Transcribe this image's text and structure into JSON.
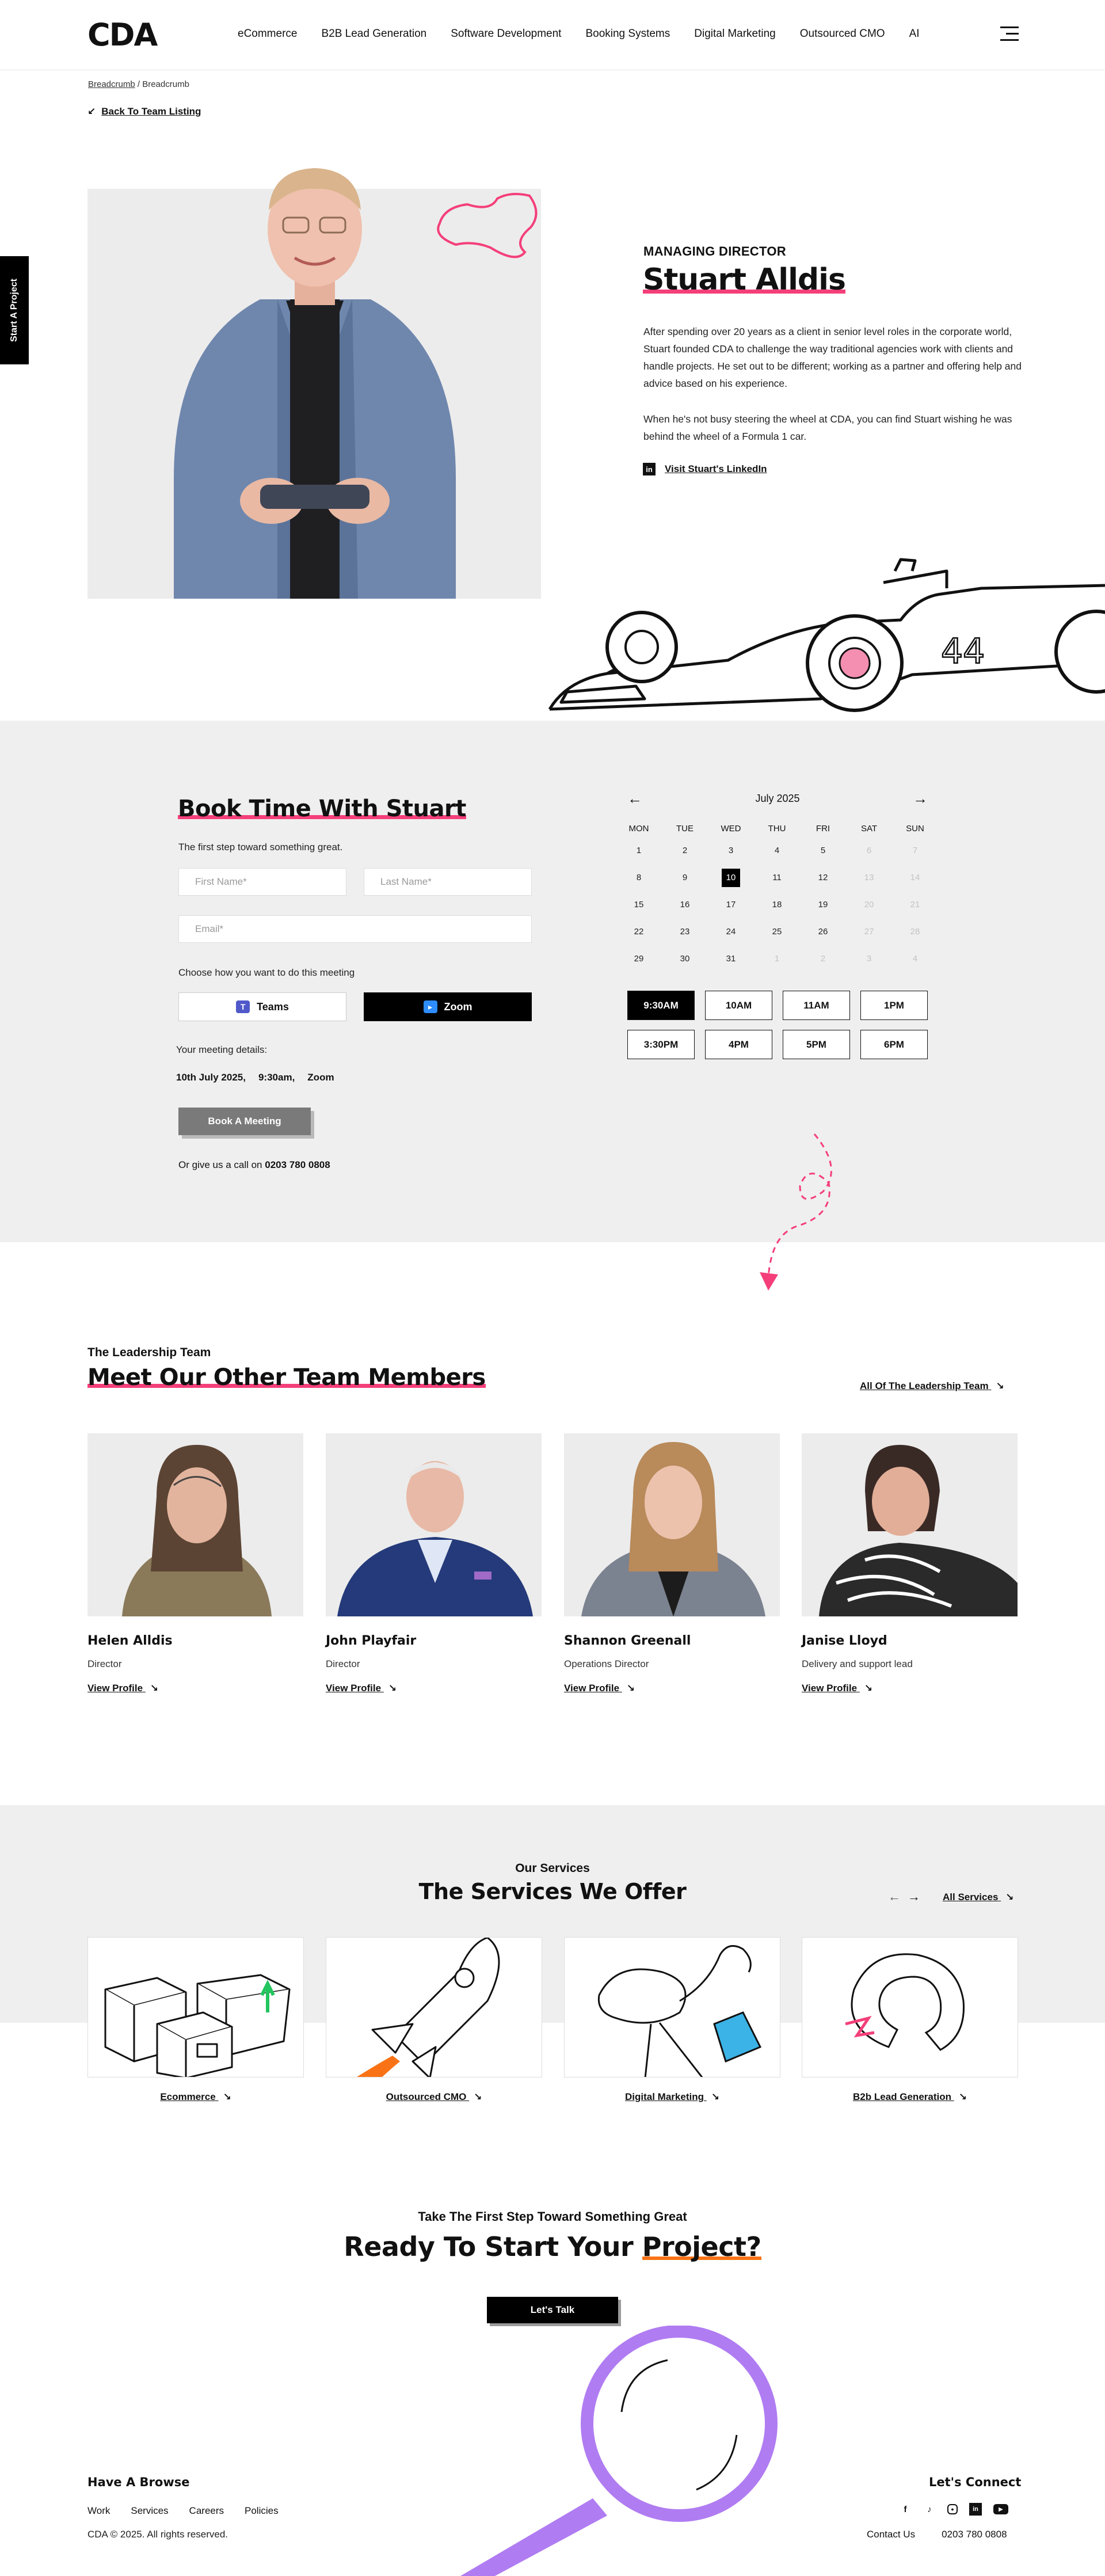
{
  "header": {
    "logo": "CDA",
    "nav": [
      "eCommerce",
      "B2B Lead Generation",
      "Software Development",
      "Booking Systems",
      "Digital Marketing",
      "Outsourced CMO",
      "AI"
    ]
  },
  "side_tab": "Start A Project",
  "breadcrumb": {
    "first": "Breadcrumb",
    "sep": " / ",
    "current": "Breadcrumb"
  },
  "back_link": "Back To Team Listing",
  "profile": {
    "role": "MANAGING DIRECTOR",
    "name": "Stuart Alldis",
    "bio1": "After spending over 20 years as a client in senior level roles in the corporate world, Stuart founded CDA to challenge the way traditional agencies work with clients and handle projects. He set out to be different; working as a partner and offering help and advice based on his experience.",
    "bio2": "When he's not busy steering the wheel at CDA, you can find Stuart wishing he was behind the wheel of a Formula 1 car.",
    "linkedin": "Visit Stuart's LinkedIn",
    "car_number": "44"
  },
  "booking": {
    "title": "Book Time With Stuart",
    "subtitle": "The first step toward something great.",
    "first_name_ph": "First Name*",
    "last_name_ph": "Last Name*",
    "email_ph": "Email*",
    "method_label": "Choose how you want to do this meeting",
    "teams": "Teams",
    "zoom": "Zoom",
    "details_label": "Your meeting details:",
    "details_date": "10th July 2025,",
    "details_time": "9:30am,",
    "details_method": "Zoom",
    "button": "Book A Meeting",
    "call_text": "Or give us a call on",
    "phone": "0203 780 0808"
  },
  "calendar": {
    "prev": "←",
    "next": "→",
    "month": "July 2025",
    "days": [
      "MON",
      "TUE",
      "WED",
      "THU",
      "FRI",
      "SAT",
      "SUN"
    ],
    "weeks": [
      [
        [
          "1",
          1
        ],
        [
          "2",
          1
        ],
        [
          "3",
          1
        ],
        [
          "4",
          1
        ],
        [
          "5",
          1
        ],
        [
          "6",
          0
        ],
        [
          "7",
          0
        ]
      ],
      [
        [
          "8",
          1
        ],
        [
          "9",
          1
        ],
        [
          "10",
          2
        ],
        [
          "11",
          1
        ],
        [
          "12",
          1
        ],
        [
          "13",
          0
        ],
        [
          "14",
          0
        ]
      ],
      [
        [
          "15",
          1
        ],
        [
          "16",
          1
        ],
        [
          "17",
          1
        ],
        [
          "18",
          1
        ],
        [
          "19",
          1
        ],
        [
          "20",
          0
        ],
        [
          "21",
          0
        ]
      ],
      [
        [
          "22",
          1
        ],
        [
          "23",
          1
        ],
        [
          "24",
          1
        ],
        [
          "25",
          1
        ],
        [
          "26",
          1
        ],
        [
          "27",
          0
        ],
        [
          "28",
          0
        ]
      ],
      [
        [
          "29",
          1
        ],
        [
          "30",
          1
        ],
        [
          "31",
          1
        ],
        [
          "1",
          0
        ],
        [
          "2",
          0
        ],
        [
          "3",
          0
        ],
        [
          "4",
          0
        ]
      ]
    ],
    "slots": [
      "9:30AM",
      "10AM",
      "11AM",
      "1PM",
      "3:30PM",
      "4PM",
      "5PM",
      "6PM"
    ],
    "selected_slot": "9:30AM"
  },
  "team": {
    "kicker": "The Leadership Team",
    "title": "Meet Our Other Team Members",
    "all_link": "All Of The Leadership Team",
    "view_label": "View Profile",
    "members": [
      {
        "name": "Helen Alldis",
        "role": "Director"
      },
      {
        "name": "John Playfair",
        "role": "Director"
      },
      {
        "name": "Shannon Greenall",
        "role": "Operations Director"
      },
      {
        "name": "Janise Lloyd",
        "role": "Delivery and support lead"
      }
    ]
  },
  "services": {
    "kicker": "Our Services",
    "title": "The Services We Offer",
    "all_link": "All Services",
    "items": [
      "Ecommerce",
      "Outsourced CMO",
      "Digital Marketing",
      "B2b Lead Generation"
    ]
  },
  "cta": {
    "kicker": "Take The First Step Toward Something Great",
    "title_a": "Ready To Start Your",
    "title_b": "Project?",
    "button": "Let's Talk"
  },
  "footer": {
    "browse_title": "Have A Browse",
    "links": [
      "Work",
      "Services",
      "Careers",
      "Policies"
    ],
    "copyright": "CDA © 2025. All rights reserved.",
    "connect_title": "Let's Connect",
    "contact": "Contact Us",
    "phone": "0203 780 0808"
  },
  "colors": {
    "accent_pink": "#f43f7a",
    "accent_orange": "#f97316",
    "magnifier_purple": "#b07cf2",
    "icon_blue": "#3bb3e6"
  }
}
